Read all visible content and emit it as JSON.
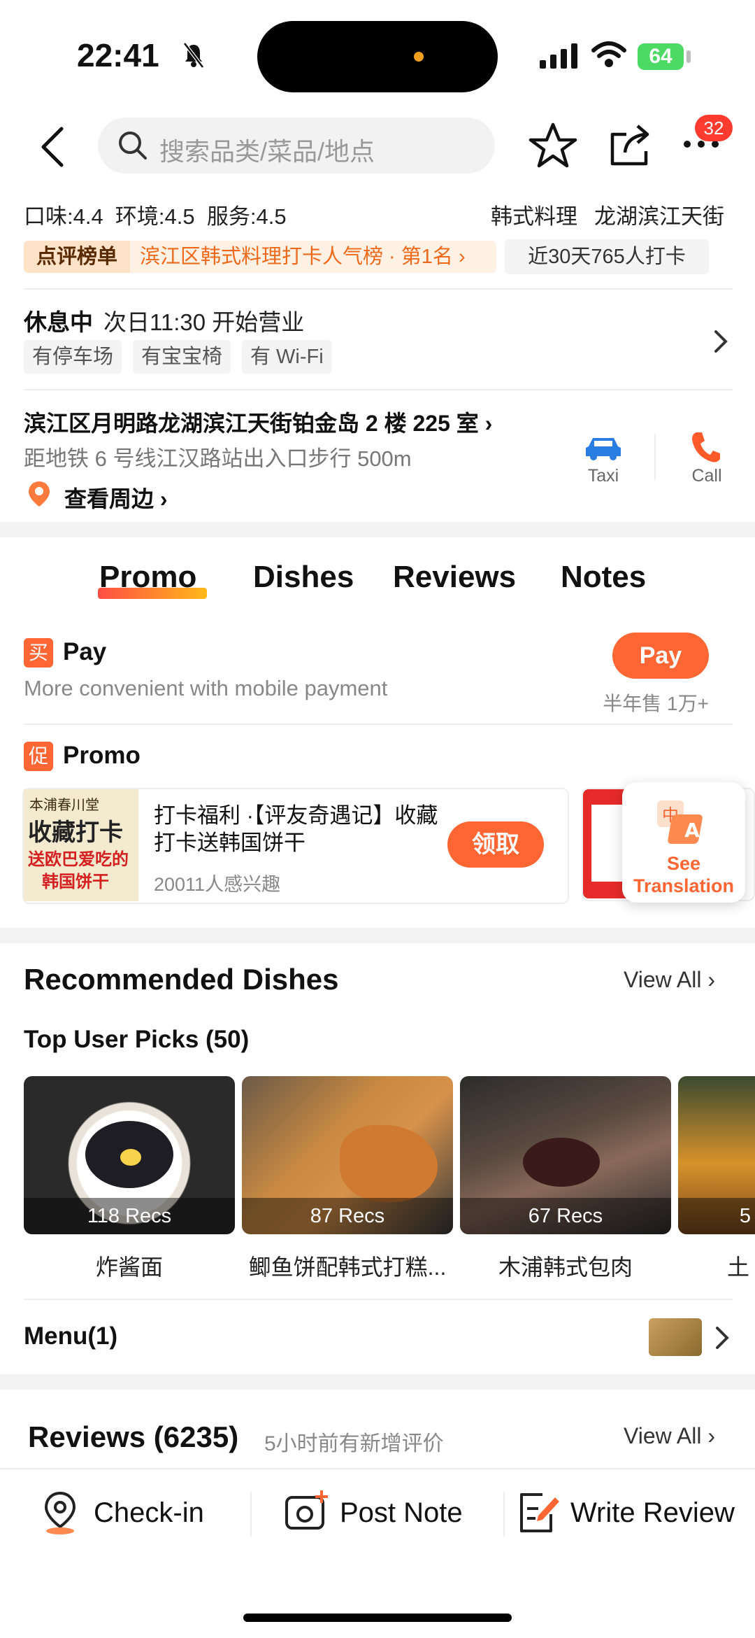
{
  "status_bar": {
    "time": "22:41",
    "battery": "64"
  },
  "header": {
    "search_placeholder": "搜索品类/菜品/地点",
    "badge_count": "32"
  },
  "ratings": {
    "text": "口味:4.4  环境:4.5  服务:4.5",
    "cuisine": "韩式料理",
    "area": "龙湖滨江天街"
  },
  "rank": {
    "tag": "点评榜单",
    "text": "滨江区韩式料理打卡人气榜 · 第1名",
    "checkins": "近30天765人打卡"
  },
  "hours": {
    "status": "休息中",
    "next_open": "次日11:30 开始营业",
    "amenities": [
      "有停车场",
      "有宝宝椅",
      "有 Wi-Fi"
    ]
  },
  "address": {
    "line": "滨江区月明路龙湖滨江天街铂金岛 2 楼 225 室",
    "transit": "距地铁 6 号线江汉路站出入口步行 500m",
    "nearby": "查看周边",
    "taxi": "Taxi",
    "call": "Call"
  },
  "tabs": [
    "Promo",
    "Dishes",
    "Reviews",
    "Notes"
  ],
  "pay": {
    "icon_char": "买",
    "title": "Pay",
    "desc": "More convenient with mobile payment",
    "button": "Pay",
    "sales": "半年售 1万+"
  },
  "promo": {
    "icon_char": "促",
    "title": "Promo",
    "card_title": "打卡福利 ·【评友奇遇记】收藏打卡送韩国饼干",
    "card_interest": "20011人感兴趣",
    "claim": "领取",
    "poster_brand": "本浦春川堂",
    "poster_line1": "收藏打卡",
    "poster_line2": "送欧巴爱吃的",
    "poster_line3": "韩国饼干"
  },
  "translate": {
    "label": "See Translation"
  },
  "recommended": {
    "title": "Recommended Dishes",
    "view_all": "View All",
    "subtitle": "Top User Picks (50)",
    "dishes": [
      {
        "recs": "118 Recs",
        "name": "炸酱面"
      },
      {
        "recs": "87 Recs",
        "name": "鲫鱼饼配韩式打糕..."
      },
      {
        "recs": "67 Recs",
        "name": "木浦韩式包肉"
      },
      {
        "recs": "5",
        "name": "土"
      }
    ]
  },
  "menu": {
    "label": "Menu(1)"
  },
  "reviews": {
    "title": "Reviews (6235)",
    "note": "5小时前有新增评价",
    "view_all": "View All"
  },
  "bottom_bar": {
    "checkin": "Check-in",
    "post_note": "Post Note",
    "write_review": "Write Review"
  },
  "colors": {
    "accent": "#ff6633",
    "badge": "#ff3b30",
    "battery": "#4cd964",
    "rank_text": "#ee6a1a"
  }
}
